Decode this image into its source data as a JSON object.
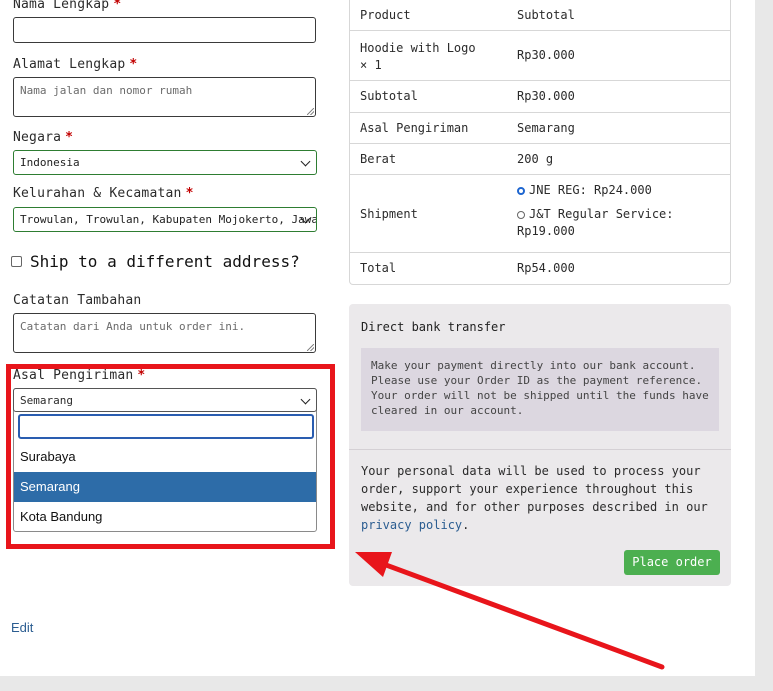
{
  "form": {
    "full_name": {
      "label": "Nama Lengkap",
      "required_mark": "*"
    },
    "address": {
      "label": "Alamat Lengkap",
      "required_mark": "*",
      "placeholder": "Nama jalan dan nomor rumah"
    },
    "country": {
      "label": "Negara",
      "required_mark": "*",
      "value": "Indonesia"
    },
    "district": {
      "label": "Kelurahan & Kecamatan",
      "required_mark": "*",
      "value": "Trowulan, Trowulan, Kabupaten Mojokerto, Jawa…"
    },
    "ship_different": {
      "label": "Ship to a different address?",
      "checked": false
    },
    "notes": {
      "label": "Catatan Tambahan",
      "placeholder": "Catatan dari Anda untuk order ini."
    },
    "origin": {
      "label": "Asal Pengiriman",
      "required_mark": "*",
      "value": "Semarang",
      "options": [
        {
          "label": "Surabaya",
          "selected": false
        },
        {
          "label": "Semarang",
          "selected": true
        },
        {
          "label": "Kota Bandung",
          "selected": false
        }
      ]
    }
  },
  "edit_link": "Edit",
  "order": {
    "header": {
      "product": "Product",
      "subtotal": "Subtotal"
    },
    "item": {
      "name_line1": "Hoodie with Logo",
      "name_line2": "× 1",
      "price": "Rp30.000"
    },
    "rows": {
      "subtotal": {
        "label": "Subtotal",
        "value": "Rp30.000"
      },
      "origin": {
        "label": "Asal Pengiriman",
        "value": "Semarang"
      },
      "weight": {
        "label": "Berat",
        "value": "200 g"
      },
      "shipment": {
        "label": "Shipment",
        "options": [
          {
            "label": "JNE REG: Rp24.000",
            "checked": true
          },
          {
            "label": "J&T Regular Service:",
            "label2": "Rp19.000",
            "checked": false
          }
        ]
      },
      "total": {
        "label": "Total",
        "value": "Rp54.000"
      }
    }
  },
  "payment": {
    "method": "Direct bank transfer",
    "description_lines": [
      "Make your payment directly into our bank account.",
      "Please use your Order ID as the payment reference.",
      "Your order will not be shipped until the funds have",
      "cleared in our account."
    ],
    "privacy_text": "Your personal data will be used to process your order, support your experience throughout this website, and for other purposes described in our",
    "privacy_link": "privacy policy",
    "privacy_end": ".",
    "place_order": "Place order"
  },
  "colors": {
    "accent_green": "#4caf50",
    "annotation_red": "#e8151b",
    "selected_blue": "#2d6ca8",
    "link_blue": "#2b5d91"
  }
}
